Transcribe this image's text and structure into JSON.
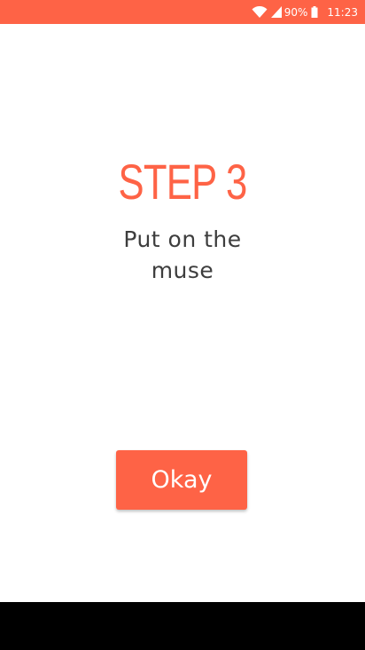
{
  "status_bar": {
    "battery_percent": "90%",
    "time": "11:23",
    "icons": [
      "wifi-icon",
      "signal-icon",
      "battery-icon"
    ]
  },
  "content": {
    "step_title": "STEP 3",
    "description": "Put on the muse"
  },
  "okay_button": {
    "label": "Okay"
  },
  "colors": {
    "accent": "#fe6346",
    "text": "#3d3d3d",
    "background": "#ffffff",
    "nav_bar": "#000000"
  }
}
